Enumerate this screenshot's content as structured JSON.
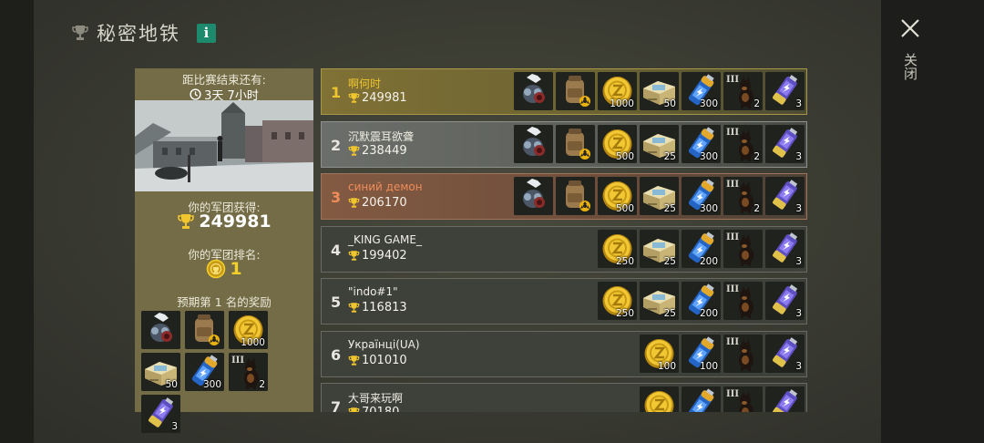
{
  "header": {
    "title": "秘密地铁",
    "info_label": "i",
    "close_label": "关闭"
  },
  "left_panel": {
    "countdown_label": "距比赛结束还有:",
    "countdown_value": "3天 7小时",
    "earned_label": "你的军团获得:",
    "earned_value": "249981",
    "rank_label": "你的军团排名:",
    "rank_value": "1",
    "reward_label": "预期第 1 名的奖励",
    "rewards": [
      {
        "icon": "gas-mask-icon",
        "count": ""
      },
      {
        "icon": "backpack-icon",
        "count": ""
      },
      {
        "icon": "gold-coin-icon",
        "count": "1000"
      },
      {
        "icon": "supply-crate-icon",
        "count": "50"
      },
      {
        "icon": "blue-battery-icon",
        "count": "300"
      },
      {
        "icon": "guard-dog-icon",
        "count": "2"
      },
      {
        "icon": "purple-battery-icon",
        "count": "3"
      }
    ]
  },
  "rows": [
    {
      "rank": "1",
      "name": "啊何时",
      "score": "249981",
      "items": [
        {
          "icon": "gas-mask-icon",
          "count": ""
        },
        {
          "icon": "backpack-icon",
          "count": ""
        },
        {
          "icon": "gold-coin-icon",
          "count": "1000"
        },
        {
          "icon": "supply-crate-icon",
          "count": "50"
        },
        {
          "icon": "blue-battery-icon",
          "count": "300"
        },
        {
          "icon": "guard-dog-icon",
          "count": "2"
        },
        {
          "icon": "purple-battery-icon",
          "count": "3"
        }
      ]
    },
    {
      "rank": "2",
      "name": "沉默震耳欲聋",
      "score": "238449",
      "items": [
        {
          "icon": "gas-mask-icon",
          "count": ""
        },
        {
          "icon": "backpack-icon",
          "count": ""
        },
        {
          "icon": "gold-coin-icon",
          "count": "500"
        },
        {
          "icon": "supply-crate-icon",
          "count": "25"
        },
        {
          "icon": "blue-battery-icon",
          "count": "300"
        },
        {
          "icon": "guard-dog-icon",
          "count": "2"
        },
        {
          "icon": "purple-battery-icon",
          "count": "3"
        }
      ]
    },
    {
      "rank": "3",
      "name": "синий демон",
      "score": "206170",
      "items": [
        {
          "icon": "gas-mask-icon",
          "count": ""
        },
        {
          "icon": "backpack-icon",
          "count": ""
        },
        {
          "icon": "gold-coin-icon",
          "count": "500"
        },
        {
          "icon": "supply-crate-icon",
          "count": "25"
        },
        {
          "icon": "blue-battery-icon",
          "count": "300"
        },
        {
          "icon": "guard-dog-icon",
          "count": "2"
        },
        {
          "icon": "purple-battery-icon",
          "count": "3"
        }
      ]
    },
    {
      "rank": "4",
      "name": "_KING GAME_",
      "score": "199402",
      "items": [
        {
          "icon": "gold-coin-icon",
          "count": "250"
        },
        {
          "icon": "supply-crate-icon",
          "count": "25"
        },
        {
          "icon": "blue-battery-icon",
          "count": "200"
        },
        {
          "icon": "guard-dog-icon",
          "count": ""
        },
        {
          "icon": "purple-battery-icon",
          "count": "3"
        }
      ]
    },
    {
      "rank": "5",
      "name": "\"indo#1\"",
      "score": "116813",
      "items": [
        {
          "icon": "gold-coin-icon",
          "count": "250"
        },
        {
          "icon": "supply-crate-icon",
          "count": "25"
        },
        {
          "icon": "blue-battery-icon",
          "count": "200"
        },
        {
          "icon": "guard-dog-icon",
          "count": ""
        },
        {
          "icon": "purple-battery-icon",
          "count": "3"
        }
      ]
    },
    {
      "rank": "6",
      "name": "Українці(UA)",
      "score": "101010",
      "items": [
        {
          "icon": "gold-coin-icon",
          "count": "100"
        },
        {
          "icon": "blue-battery-icon",
          "count": "100"
        },
        {
          "icon": "guard-dog-icon",
          "count": ""
        },
        {
          "icon": "purple-battery-icon",
          "count": "3"
        }
      ]
    },
    {
      "rank": "7",
      "name": "大哥来玩啊",
      "score": "70180",
      "items": [
        {
          "icon": "gold-coin-icon",
          "count": ""
        },
        {
          "icon": "blue-battery-icon",
          "count": ""
        },
        {
          "icon": "guard-dog-icon",
          "count": ""
        },
        {
          "icon": "purple-battery-icon",
          "count": ""
        }
      ]
    }
  ],
  "colors": {
    "gold": "#f0c62e",
    "orange": "#ef8c5a",
    "teal": "#1d8a6e"
  }
}
